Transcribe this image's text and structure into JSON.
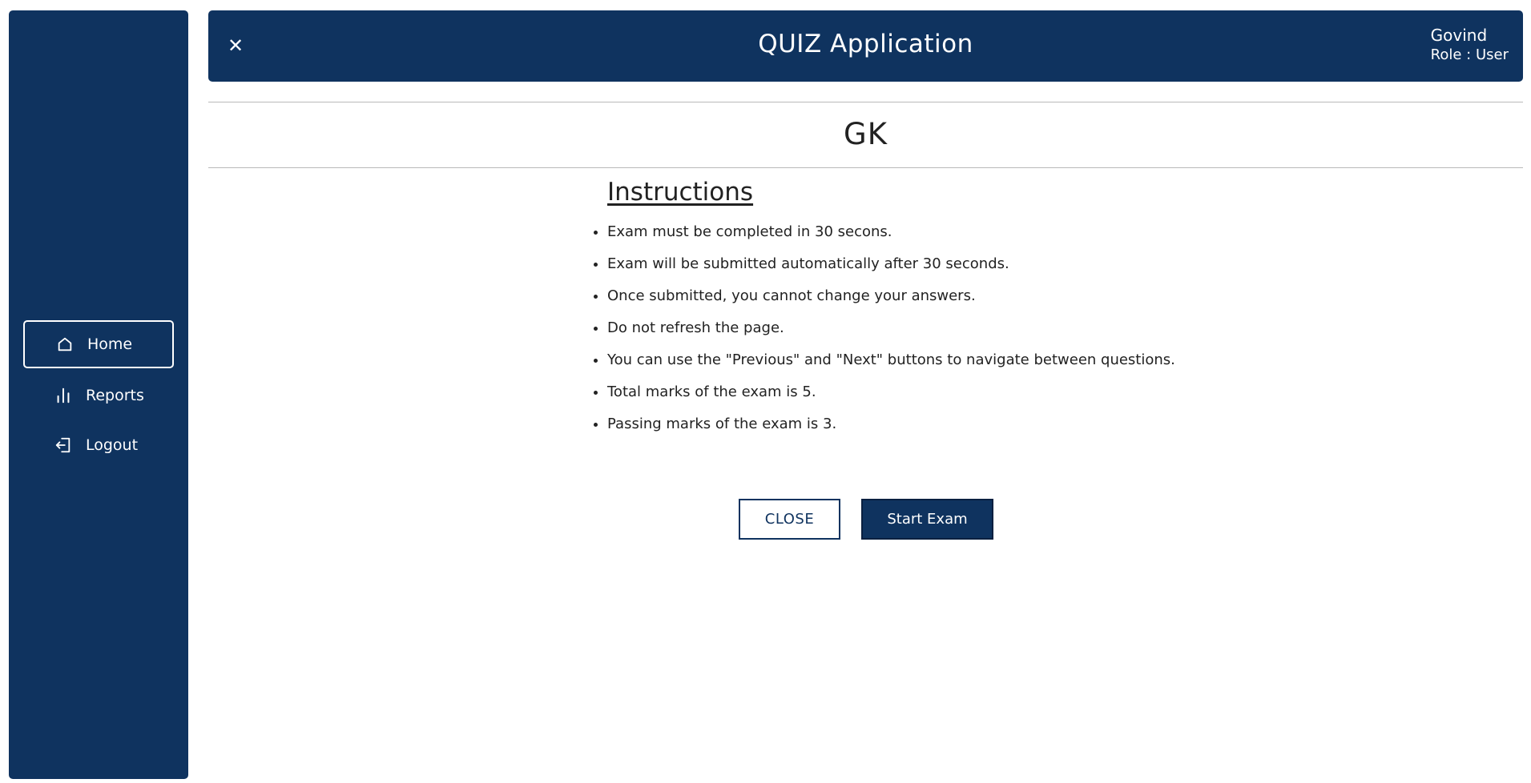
{
  "header": {
    "title": "QUIZ Application",
    "close_icon": "close-icon",
    "user_name": "Govind",
    "user_role": "Role : User"
  },
  "sidebar": {
    "items": [
      {
        "label": "Home",
        "icon": "home-icon",
        "active": true
      },
      {
        "label": "Reports",
        "icon": "bar-chart-icon",
        "active": false
      },
      {
        "label": "Logout",
        "icon": "logout-icon",
        "active": false
      }
    ]
  },
  "exam": {
    "subject": "GK",
    "instructions_title": "Instructions",
    "instructions": [
      "Exam must be completed in 30 secons.",
      "Exam will be submitted automatically after 30 seconds.",
      "Once submitted, you cannot change your answers.",
      "Do not refresh the page.",
      "You can use the \"Previous\" and \"Next\" buttons to navigate between questions.",
      "Total marks of the exam is 5.",
      "Passing marks of the exam is 3."
    ],
    "close_label": "CLOSE",
    "start_label": "Start Exam"
  },
  "colors": {
    "primary": "#0f335f",
    "background": "#ffffff",
    "divider": "#b9b9b9",
    "text": "#222222"
  }
}
